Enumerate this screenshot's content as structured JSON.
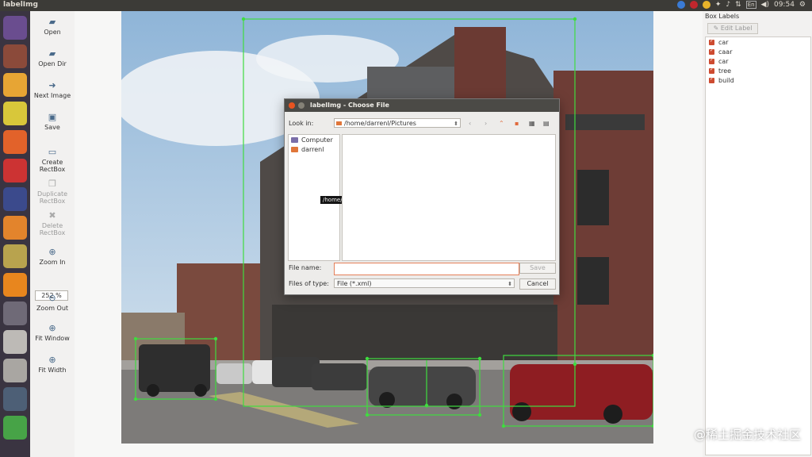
{
  "window": {
    "title": "labelImg"
  },
  "top_panel": {
    "clock": "09:54",
    "keyboard": "En"
  },
  "toolbar": {
    "open": "Open",
    "open_dir": "Open Dir",
    "next_image": "Next Image",
    "save": "Save",
    "create_rectbox": [
      "Create",
      "RectBox"
    ],
    "duplicate_rectbox": [
      "Duplicate",
      "RectBox"
    ],
    "delete_rectbox": [
      "Delete",
      "RectBox"
    ],
    "zoom_in": "Zoom In",
    "zoom_value": "252 %",
    "zoom_out": "Zoom Out",
    "fit_window": "Fit Window",
    "fit_width": "Fit Width"
  },
  "right_panel": {
    "header": "Box Labels",
    "edit_label": "Edit Label",
    "labels": [
      "car",
      "caar",
      "car",
      "tree",
      "build"
    ],
    "checkbox_color": "#cd4b30"
  },
  "dialog": {
    "title": "labelImg - Choose File",
    "look_in_label": "Look in:",
    "look_in_value": "/home/darrenl/Pictures",
    "places": [
      "Computer",
      "darrenl"
    ],
    "tooltip": "/home/darrenl",
    "file_name_label": "File name:",
    "file_name_value": "",
    "files_of_type_label": "Files of type:",
    "files_of_type_value": "File (*.xml)",
    "save_button": "Save",
    "cancel_button": "Cancel"
  },
  "annotation_color": "#3fdc3f",
  "watermark": "@稀土掘金技术社区"
}
